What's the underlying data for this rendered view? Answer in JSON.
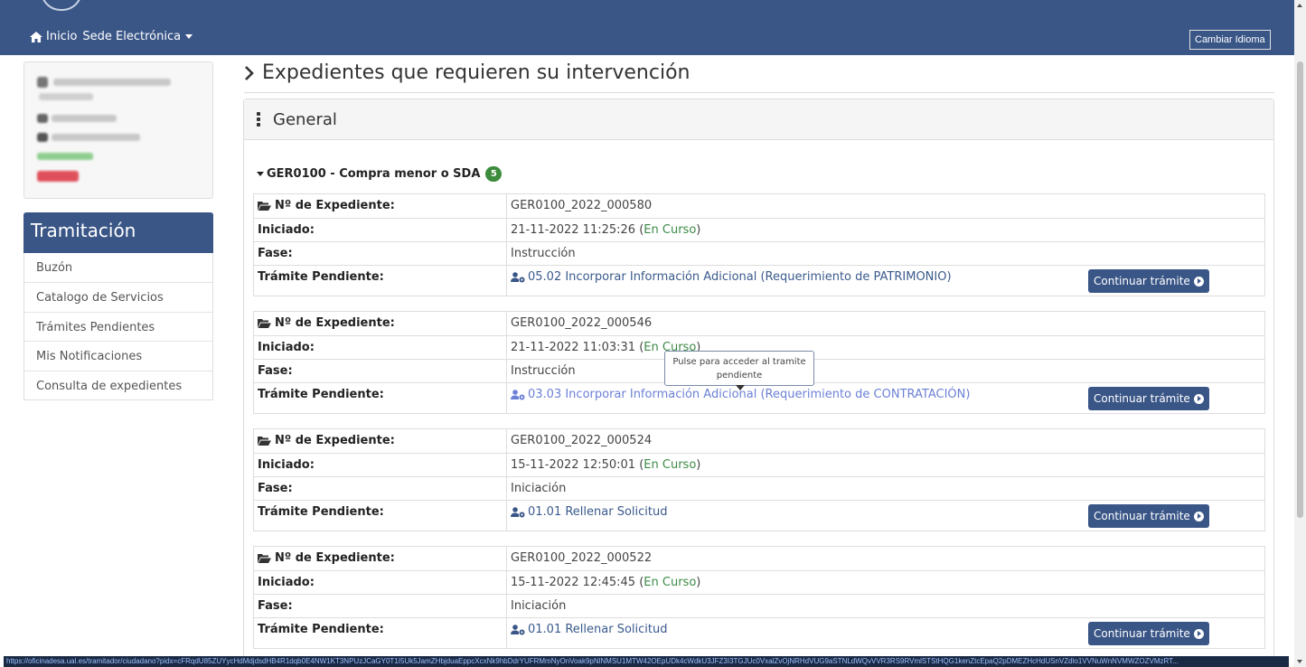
{
  "nav": {
    "home_label": "Inicio",
    "sede_label": "Sede Electrónica",
    "language_button": "Cambiar Idioma"
  },
  "sidebar": {
    "section_title": "Tramitación",
    "items": [
      {
        "label": "Buzón"
      },
      {
        "label": "Catalogo de Servicios"
      },
      {
        "label": "Trámites Pendientes"
      },
      {
        "label": "Mis Notificaciones"
      },
      {
        "label": "Consulta de expedientes"
      }
    ]
  },
  "main": {
    "title": "Expedientes que requieren su intervención",
    "panel_title": "General",
    "group": {
      "title": "GER0100 - Compra menor o SDA",
      "count": "5"
    },
    "labels": {
      "expediente": "Nº de Expediente:",
      "iniciado": "Iniciado:",
      "fase": "Fase:",
      "tramite": "Trámite Pendiente:"
    },
    "continue_label": "Continuar trámite",
    "expedientes": [
      {
        "numero": "GER0100_2022_000580",
        "fecha": "21-11-2022 11:25:26",
        "estado": "En Curso",
        "fase": "Instrucción",
        "tramite": "05.02 Incorporar Información Adicional (Requerimiento de PATRIMONIO)"
      },
      {
        "numero": "GER0100_2022_000546",
        "fecha": "21-11-2022 11:03:31",
        "estado": "En Curso",
        "fase": "Instrucción",
        "tramite": "03.03 Incorporar Información Adicional (Requerimiento de CONTRATACIÓN)"
      },
      {
        "numero": "GER0100_2022_000524",
        "fecha": "15-11-2022 12:50:01",
        "estado": "En Curso",
        "fase": "Iniciación",
        "tramite": "01.01 Rellenar Solicitud"
      },
      {
        "numero": "GER0100_2022_000522",
        "fecha": "15-11-2022 12:45:45",
        "estado": "En Curso",
        "fase": "Iniciación",
        "tramite": "01.01 Rellenar Solicitud"
      }
    ]
  },
  "tooltip": {
    "line1": "Pulse para acceder al tramite",
    "line2": "pendiente"
  },
  "statusbar": {
    "url": "https://oficinadesa.ual.es/tramitador/ciudadano?pidx=cFRqdU85ZUYycHdMdjdsdHB4R1dqb0E4NW1KT3NPUzJCaGY0T1I5Uk5JamZHbjduaEppcXcxNk9hbDdrYUFRMmNyOnVoak9pNlNMSU1MTW42OEpUDk4cWdkU3JFZ3I3TGJUc0VxalZvOjNRHdVUG9aSTNLdWQvVVR3RS9RVmlSTStHQG1kenZtcEpaQ2pDMEZHcHdUSnVZdlo1VVNuWnNVMWZOZVMzRT..."
  },
  "colors": {
    "brand": "#3a5687",
    "status_en_curso": "#3c8a45",
    "badge": "#3d8b3d"
  }
}
